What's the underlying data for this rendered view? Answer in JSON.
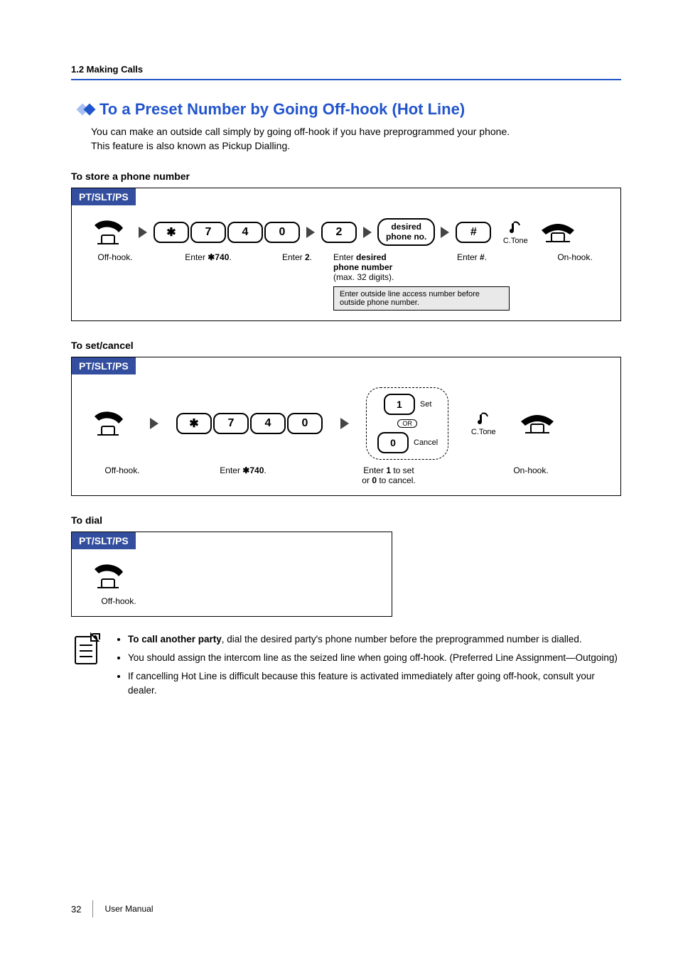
{
  "header": {
    "breadcrumb": "1.2 Making Calls"
  },
  "section": {
    "title": "To a Preset Number by Going Off-hook (Hot Line)",
    "intro1": "You can make an outside call simply by going off-hook if you have preprogrammed your phone.",
    "intro2": "This feature is also known as Pickup Dialling."
  },
  "store": {
    "heading": "To store a phone number",
    "band": "PT/SLT/PS",
    "keys": {
      "star": "✱",
      "k7": "7",
      "k4": "4",
      "k0": "0",
      "k2": "2",
      "hash": "#"
    },
    "oval_l1": "desired",
    "oval_l2": "phone no.",
    "tone_label": "C.Tone",
    "cap1": "Off-hook.",
    "cap2_a": "Enter ",
    "cap2_b": "✱740",
    "cap2_c": ".",
    "cap3_a": "Enter ",
    "cap3_b": "2",
    "cap3_c": ".",
    "cap4_l1a": "Enter ",
    "cap4_l1b": "desired",
    "cap4_l2": "phone number",
    "cap4_l3": "(max. 32 digits).",
    "cap5_a": "Enter ",
    "cap5_b": "#",
    "cap5_c": ".",
    "cap6": "On-hook.",
    "note": "Enter outside line access number before outside phone number."
  },
  "setcancel": {
    "heading": "To set/cancel",
    "band": "PT/SLT/PS",
    "keys": {
      "star": "✱",
      "k7": "7",
      "k4": "4",
      "k0": "0",
      "k1": "1",
      "kc0": "0"
    },
    "set_label": "Set",
    "or_label": "OR",
    "cancel_label": "Cancel",
    "tone_label": "C.Tone",
    "cap1": "Off-hook.",
    "cap2_a": "Enter ",
    "cap2_b": "✱740",
    "cap2_c": ".",
    "cap3_l1a": "Enter ",
    "cap3_l1b": "1",
    "cap3_l1c": " to set",
    "cap3_l2a": "or ",
    "cap3_l2b": "0",
    "cap3_l2c": " to cancel.",
    "cap4": "On-hook."
  },
  "dial": {
    "heading": "To dial",
    "band": "PT/SLT/PS",
    "cap1": "Off-hook."
  },
  "tips": {
    "b1a": "To call another party",
    "b1b": ", dial the desired party's phone number before the preprogrammed number is dialled.",
    "b2": "You should assign the intercom line as the seized line when going off-hook. (Preferred Line Assignment—Outgoing)",
    "b3": "If cancelling Hot Line is difficult because this feature is activated immediately after going off-hook, consult your dealer."
  },
  "footer": {
    "page": "32",
    "label": "User Manual"
  }
}
